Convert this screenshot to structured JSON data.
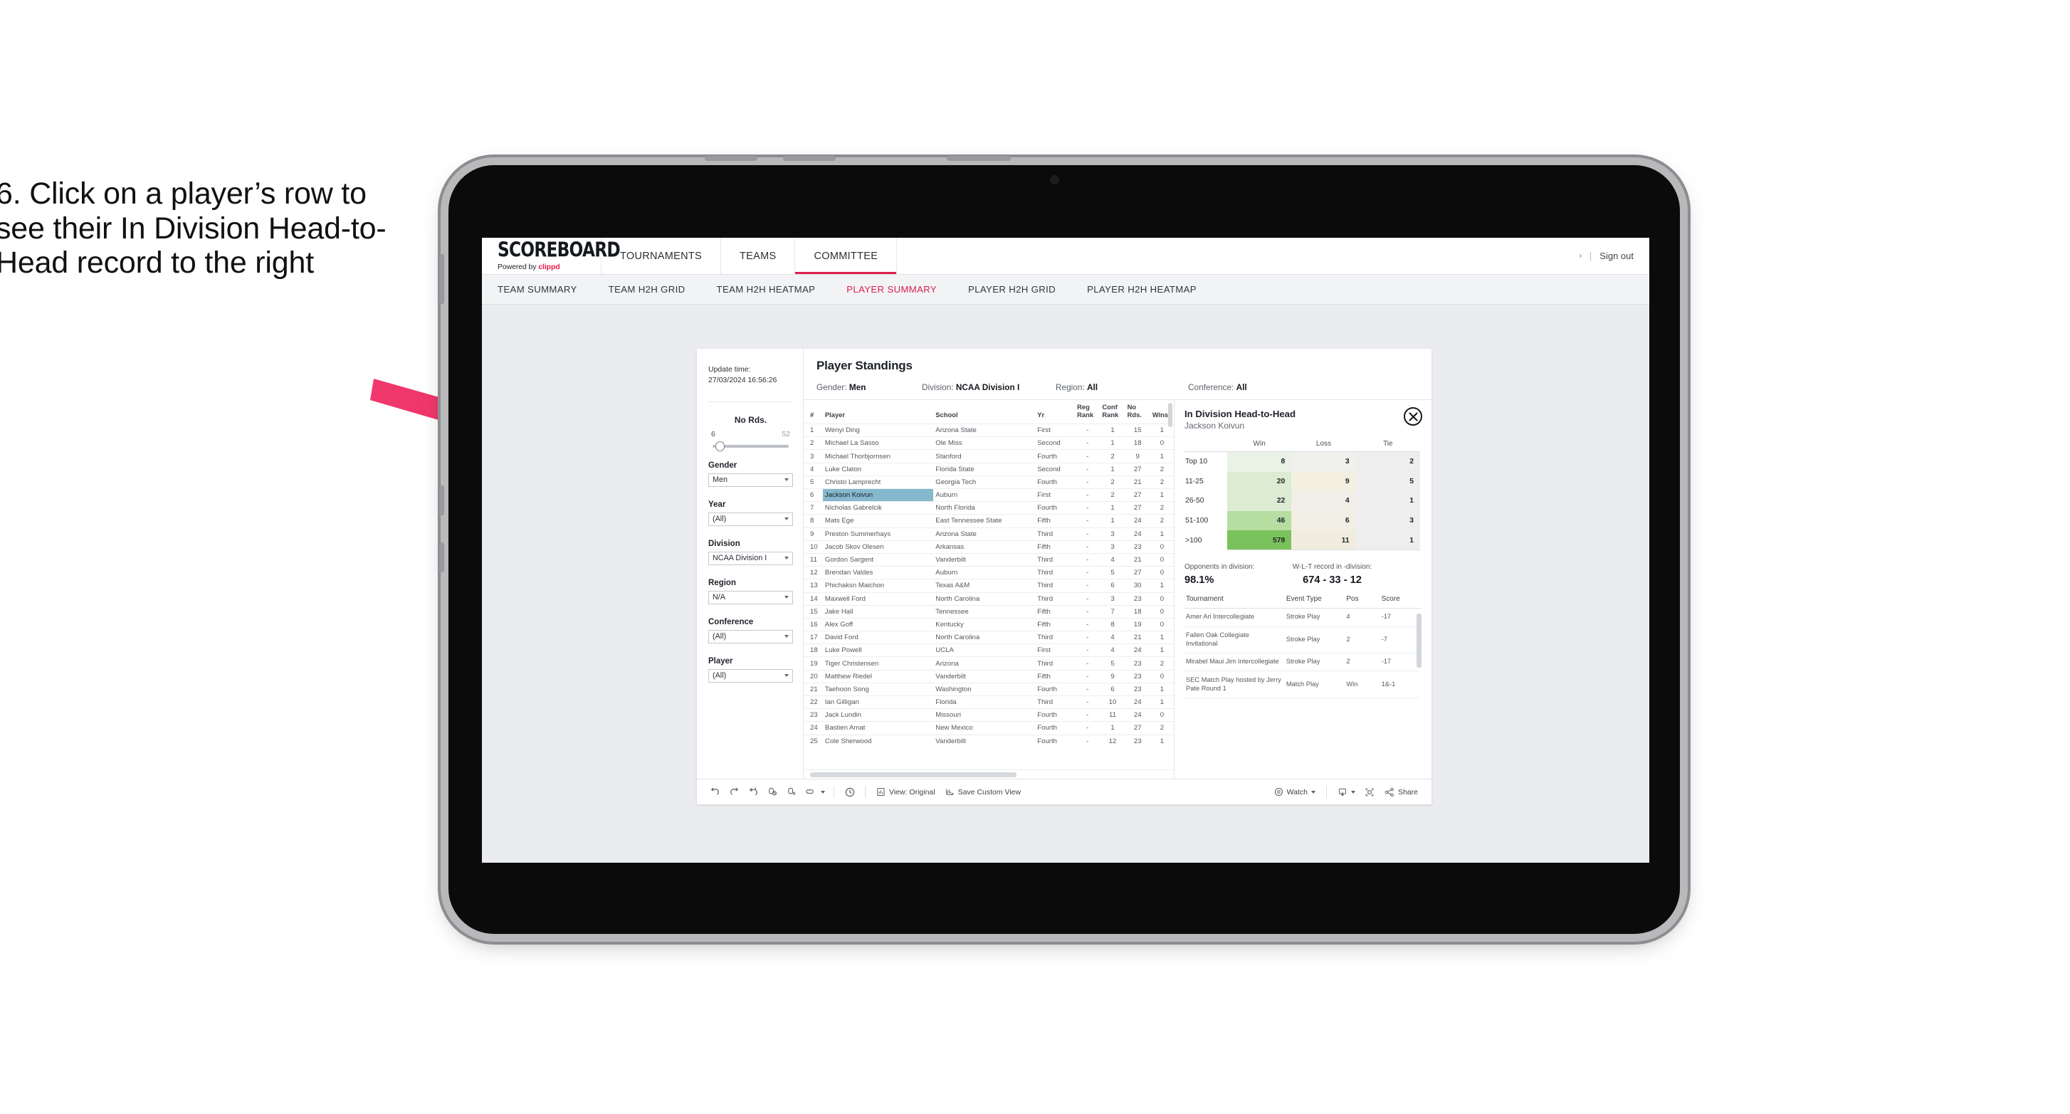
{
  "instruction": "6. Click on a player’s row to see their In Division Head-to-Head record to the right",
  "header": {
    "logo_main": "SCOREBOARD",
    "logo_sub_prefix": "Powered by ",
    "logo_sub_brand": "clippd",
    "tabs": [
      {
        "label": "TOURNAMENTS",
        "active": false
      },
      {
        "label": "TEAMS",
        "active": false
      },
      {
        "label": "COMMITTEE",
        "active": true
      }
    ],
    "account_caret": "›",
    "separator": "|",
    "sign_out": "Sign out"
  },
  "sub_nav": {
    "tabs": [
      {
        "label": "TEAM SUMMARY",
        "active": false
      },
      {
        "label": "TEAM H2H GRID",
        "active": false
      },
      {
        "label": "TEAM H2H HEATMAP",
        "active": false
      },
      {
        "label": "PLAYER SUMMARY",
        "active": true
      },
      {
        "label": "PLAYER H2H GRID",
        "active": false
      },
      {
        "label": "PLAYER H2H HEATMAP",
        "active": false
      }
    ]
  },
  "filters": {
    "update_time_label": "Update time:",
    "update_time_value": "27/03/2024 16:56:26",
    "slider": {
      "title": "No Rds.",
      "min": "6",
      "max": "52"
    },
    "fields": [
      {
        "label": "Gender",
        "value": "Men"
      },
      {
        "label": "Year",
        "value": "(All)"
      },
      {
        "label": "Division",
        "value": "NCAA Division I"
      },
      {
        "label": "Region",
        "value": "N/A"
      },
      {
        "label": "Conference",
        "value": "(All)"
      },
      {
        "label": "Player",
        "value": "(All)"
      }
    ]
  },
  "standings": {
    "title": "Player Standings",
    "meta": [
      {
        "label": "Gender:",
        "value": "Men"
      },
      {
        "label": "Division:",
        "value": "NCAA Division I"
      },
      {
        "label": "Region:",
        "value": "All"
      },
      {
        "label": "Conference:",
        "value": "All"
      }
    ],
    "columns": [
      "#",
      "Player",
      "School",
      "Yr",
      "Reg Rank",
      "Conf Rank",
      "No Rds.",
      "Wins"
    ],
    "rows": [
      {
        "rank": "1",
        "player": "Wenyi Ding",
        "school": "Arizona State",
        "yr": "First",
        "reg": "-",
        "conf": "1",
        "rds": "15",
        "wins": "1",
        "selected": false
      },
      {
        "rank": "2",
        "player": "Michael La Sasso",
        "school": "Ole Miss",
        "yr": "Second",
        "reg": "-",
        "conf": "1",
        "rds": "18",
        "wins": "0",
        "selected": false
      },
      {
        "rank": "3",
        "player": "Michael Thorbjornsen",
        "school": "Stanford",
        "yr": "Fourth",
        "reg": "-",
        "conf": "2",
        "rds": "9",
        "wins": "1",
        "selected": false
      },
      {
        "rank": "4",
        "player": "Luke Claton",
        "school": "Florida State",
        "yr": "Second",
        "reg": "-",
        "conf": "1",
        "rds": "27",
        "wins": "2",
        "selected": false
      },
      {
        "rank": "5",
        "player": "Christo Lamprecht",
        "school": "Georgia Tech",
        "yr": "Fourth",
        "reg": "-",
        "conf": "2",
        "rds": "21",
        "wins": "2",
        "selected": false
      },
      {
        "rank": "6",
        "player": "Jackson Koivun",
        "school": "Auburn",
        "yr": "First",
        "reg": "-",
        "conf": "2",
        "rds": "27",
        "wins": "1",
        "selected": true
      },
      {
        "rank": "7",
        "player": "Nicholas Gabrelcik",
        "school": "North Florida",
        "yr": "Fourth",
        "reg": "-",
        "conf": "1",
        "rds": "27",
        "wins": "2",
        "selected": false
      },
      {
        "rank": "8",
        "player": "Mats Ege",
        "school": "East Tennessee State",
        "yr": "Fifth",
        "reg": "-",
        "conf": "1",
        "rds": "24",
        "wins": "2",
        "selected": false
      },
      {
        "rank": "9",
        "player": "Preston Summerhays",
        "school": "Arizona State",
        "yr": "Third",
        "reg": "-",
        "conf": "3",
        "rds": "24",
        "wins": "1",
        "selected": false
      },
      {
        "rank": "10",
        "player": "Jacob Skov Olesen",
        "school": "Arkansas",
        "yr": "Fifth",
        "reg": "-",
        "conf": "3",
        "rds": "23",
        "wins": "0",
        "selected": false
      },
      {
        "rank": "11",
        "player": "Gordon Sargent",
        "school": "Vanderbilt",
        "yr": "Third",
        "reg": "-",
        "conf": "4",
        "rds": "21",
        "wins": "0",
        "selected": false
      },
      {
        "rank": "12",
        "player": "Brendan Valdes",
        "school": "Auburn",
        "yr": "Third",
        "reg": "-",
        "conf": "5",
        "rds": "27",
        "wins": "0",
        "selected": false
      },
      {
        "rank": "13",
        "player": "Phichaksn Maichon",
        "school": "Texas A&M",
        "yr": "Third",
        "reg": "-",
        "conf": "6",
        "rds": "30",
        "wins": "1",
        "selected": false
      },
      {
        "rank": "14",
        "player": "Maxwell Ford",
        "school": "North Carolina",
        "yr": "Third",
        "reg": "-",
        "conf": "3",
        "rds": "23",
        "wins": "0",
        "selected": false
      },
      {
        "rank": "15",
        "player": "Jake Hall",
        "school": "Tennessee",
        "yr": "Fifth",
        "reg": "-",
        "conf": "7",
        "rds": "18",
        "wins": "0",
        "selected": false
      },
      {
        "rank": "16",
        "player": "Alex Goff",
        "school": "Kentucky",
        "yr": "Fifth",
        "reg": "-",
        "conf": "8",
        "rds": "19",
        "wins": "0",
        "selected": false
      },
      {
        "rank": "17",
        "player": "David Ford",
        "school": "North Carolina",
        "yr": "Third",
        "reg": "-",
        "conf": "4",
        "rds": "21",
        "wins": "1",
        "selected": false
      },
      {
        "rank": "18",
        "player": "Luke Powell",
        "school": "UCLA",
        "yr": "First",
        "reg": "-",
        "conf": "4",
        "rds": "24",
        "wins": "1",
        "selected": false
      },
      {
        "rank": "19",
        "player": "Tiger Christensen",
        "school": "Arizona",
        "yr": "Third",
        "reg": "-",
        "conf": "5",
        "rds": "23",
        "wins": "2",
        "selected": false
      },
      {
        "rank": "20",
        "player": "Matthew Riedel",
        "school": "Vanderbilt",
        "yr": "Fifth",
        "reg": "-",
        "conf": "9",
        "rds": "23",
        "wins": "0",
        "selected": false
      },
      {
        "rank": "21",
        "player": "Taehoon Song",
        "school": "Washington",
        "yr": "Fourth",
        "reg": "-",
        "conf": "6",
        "rds": "23",
        "wins": "1",
        "selected": false
      },
      {
        "rank": "22",
        "player": "Ian Gilligan",
        "school": "Florida",
        "yr": "Third",
        "reg": "-",
        "conf": "10",
        "rds": "24",
        "wins": "1",
        "selected": false
      },
      {
        "rank": "23",
        "player": "Jack Lundin",
        "school": "Missouri",
        "yr": "Fourth",
        "reg": "-",
        "conf": "11",
        "rds": "24",
        "wins": "0",
        "selected": false
      },
      {
        "rank": "24",
        "player": "Bastien Amat",
        "school": "New Mexico",
        "yr": "Fourth",
        "reg": "-",
        "conf": "1",
        "rds": "27",
        "wins": "2",
        "selected": false
      },
      {
        "rank": "25",
        "player": "Cole Sherwood",
        "school": "Vanderbilt",
        "yr": "Fourth",
        "reg": "-",
        "conf": "12",
        "rds": "23",
        "wins": "1",
        "selected": false
      }
    ]
  },
  "detail": {
    "title": "In Division Head-to-Head",
    "player": "Jackson Koivun",
    "close_icon": "close-circle-icon",
    "h2h_columns": [
      "",
      "Win",
      "Loss",
      "Tie"
    ],
    "h2h_rows": [
      {
        "band": "Top 10",
        "win": "8",
        "loss": "3",
        "tie": "2",
        "win_color": "#e9f2e4",
        "loss_color": "#f0f0ec",
        "tie_color": "#eeeeee"
      },
      {
        "band": "11-25",
        "win": "20",
        "loss": "9",
        "tie": "5",
        "win_color": "#dcebd2",
        "loss_color": "#f3f0e2",
        "tie_color": "#eeeeee"
      },
      {
        "band": "26-50",
        "win": "22",
        "loss": "4",
        "tie": "1",
        "win_color": "#dcebd2",
        "loss_color": "#f1efe8",
        "tie_color": "#eeeeee"
      },
      {
        "band": "51-100",
        "win": "46",
        "loss": "6",
        "tie": "3",
        "win_color": "#b6dda2",
        "loss_color": "#f1eee4",
        "tie_color": "#eeeeee"
      },
      {
        "band": ">100",
        "win": "578",
        "loss": "11",
        "tie": "1",
        "win_color": "#7ac35c",
        "loss_color": "#f2ece0",
        "tie_color": "#eeeeee"
      }
    ],
    "summary": {
      "opponents_label": "Opponents in division:",
      "opponents_value": "98.1%",
      "record_label": "W-L-T record in -division:",
      "record_value": "674 - 33 - 12"
    },
    "tournament_columns": [
      "Tournament",
      "Event Type",
      "Pos",
      "Score"
    ],
    "tournaments": [
      {
        "name": "Amer Ari Intercollegiate",
        "type": "Stroke Play",
        "pos": "4",
        "score": "-17"
      },
      {
        "name": "Fallen Oak Collegiate Invitational",
        "type": "Stroke Play",
        "pos": "2",
        "score": "-7"
      },
      {
        "name": "Mirabel Maui Jim Intercollegiate",
        "type": "Stroke Play",
        "pos": "2",
        "score": "-17"
      },
      {
        "name": "SEC Match Play hosted by Jerry Pate Round 1",
        "type": "Match Play",
        "pos": "Win",
        "score": "1&-1"
      }
    ]
  },
  "toolbar": {
    "icons": [
      "undo-icon",
      "redo-icon",
      "revert-icon",
      "refresh-data-icon",
      "pause-updates-icon",
      "highlight-icon"
    ],
    "alert_icon": "alerts-clock-icon",
    "view_label": "View: Original",
    "view_icon": "view-original-icon",
    "save_label": "Save Custom View",
    "save_icon": "save-view-icon",
    "watch_label": "Watch",
    "watch_icon": "watch-eye-icon",
    "download_icon": "download-icon",
    "fullscreen_icon": "fullscreen-icon",
    "share_label": "Share",
    "share_icon": "share-icon"
  },
  "colors": {
    "brand_pink": "#d8204f",
    "selection_blue": "#86b8cd",
    "arrow_pink": "#f0376b"
  }
}
